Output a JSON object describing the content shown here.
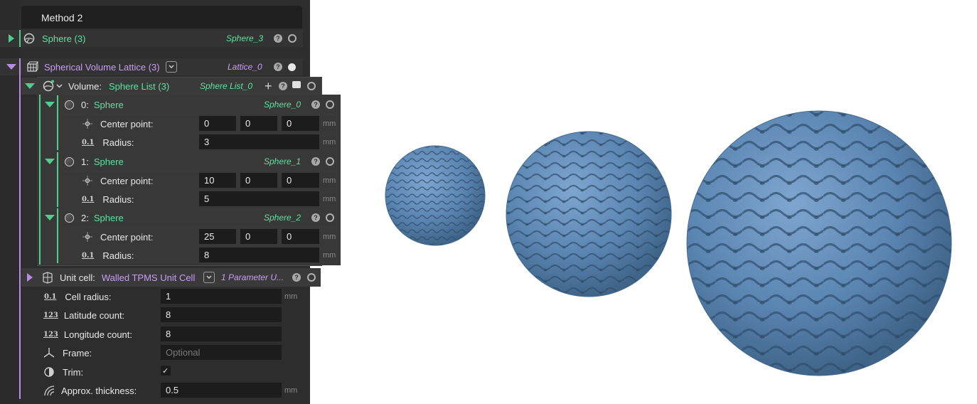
{
  "header": {
    "title": "Method 2"
  },
  "sphere_node": {
    "label": "Sphere (3)",
    "var": "Sphere_3"
  },
  "lattice_node": {
    "label": "Spherical Volume Lattice (3)",
    "var": "Lattice_0"
  },
  "volume": {
    "prefix": "Volume:",
    "label": "Sphere List (3)",
    "var": "Sphere List_0",
    "add": "+"
  },
  "spheres": [
    {
      "index": "0:",
      "label": "Sphere",
      "var": "Sphere_0",
      "center_label": "Center point:",
      "center": [
        "0",
        "0",
        "0"
      ],
      "radius_label": "Radius:",
      "radius": "3",
      "unit": "mm"
    },
    {
      "index": "1:",
      "label": "Sphere",
      "var": "Sphere_1",
      "center_label": "Center point:",
      "center": [
        "10",
        "0",
        "0"
      ],
      "radius_label": "Radius:",
      "radius": "5",
      "unit": "mm"
    },
    {
      "index": "2:",
      "label": "Sphere",
      "var": "Sphere_2",
      "center_label": "Center point:",
      "center": [
        "25",
        "0",
        "0"
      ],
      "radius_label": "Radius:",
      "radius": "8",
      "unit": "mm"
    }
  ],
  "unit_cell": {
    "prefix": "Unit cell:",
    "label": "Walled TPMS Unit Cell",
    "var": "1 Parameter U..."
  },
  "params": {
    "cell_radius": {
      "label": "Cell radius:",
      "value": "1",
      "unit": "mm"
    },
    "latitude": {
      "label": "Latitude count:",
      "value": "8"
    },
    "longitude": {
      "label": "Longitude count:",
      "value": "8"
    },
    "frame": {
      "label": "Frame:",
      "placeholder": "Optional"
    },
    "trim": {
      "label": "Trim:",
      "value": "✓"
    },
    "thickness": {
      "label": "Approx. thickness:",
      "value": "0.5",
      "unit": "mm"
    }
  },
  "icons": {
    "help": "?",
    "num_icon": "0.1",
    "int_icon": "123"
  },
  "colors": {
    "accent_green": "#4ccf8e",
    "accent_purple": "#b88be8",
    "sphere_blue": "#5b86b2"
  }
}
